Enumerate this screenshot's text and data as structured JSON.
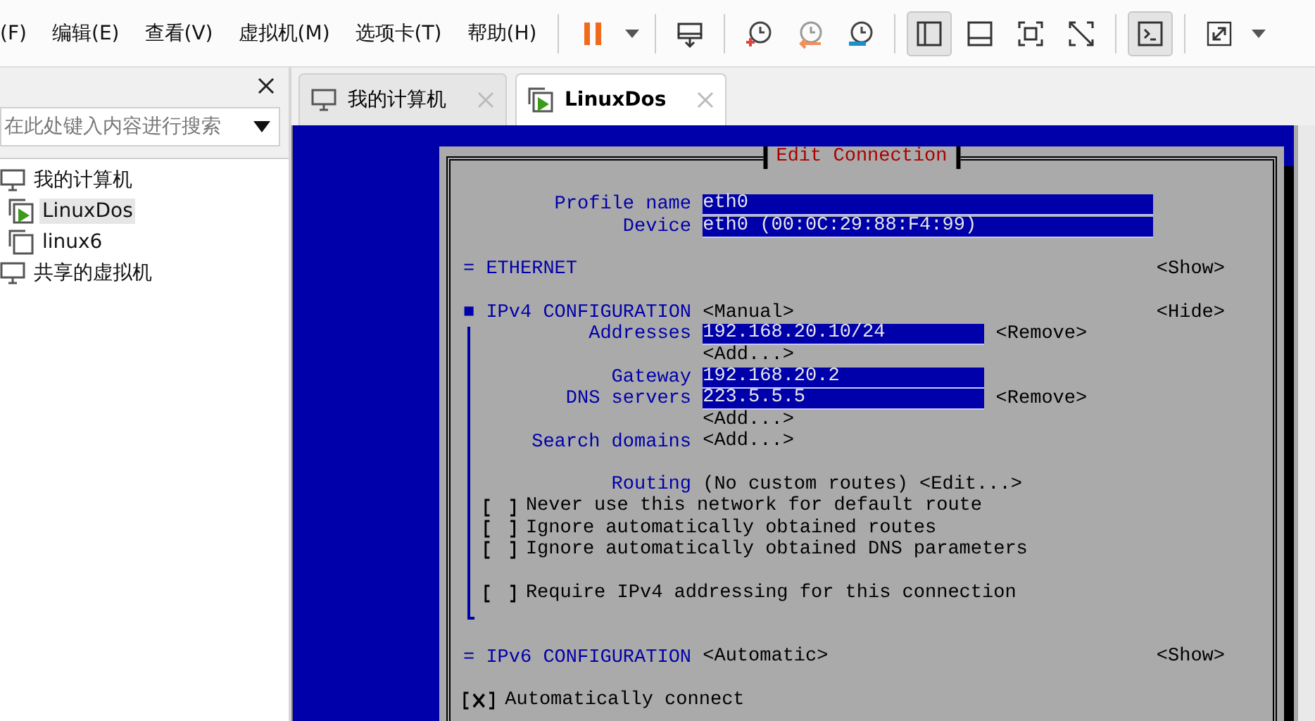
{
  "menu": [
    "(F)",
    "编辑(E)",
    "查看(V)",
    "虚拟机(M)",
    "选项卡(T)",
    "帮助(H)"
  ],
  "toolbar": [
    {
      "kind": "pause",
      "selected": false
    },
    {
      "kind": "caret",
      "selected": false
    },
    {
      "kind": "sep"
    },
    {
      "kind": "send-keys",
      "selected": false
    },
    {
      "kind": "sep"
    },
    {
      "kind": "snapshot-take",
      "selected": false
    },
    {
      "kind": "snapshot-revert",
      "selected": false
    },
    {
      "kind": "snapshot-manage",
      "selected": false
    },
    {
      "kind": "sep"
    },
    {
      "kind": "view-sidebar",
      "selected": true
    },
    {
      "kind": "view-bottom",
      "selected": false
    },
    {
      "kind": "view-fit",
      "selected": false
    },
    {
      "kind": "view-unity",
      "selected": false
    },
    {
      "kind": "sep"
    },
    {
      "kind": "console",
      "selected": true
    },
    {
      "kind": "sep"
    },
    {
      "kind": "fullscreen",
      "selected": false
    },
    {
      "kind": "caret",
      "selected": false
    }
  ],
  "sidebar": {
    "search": {
      "placeholder": "在此处键入内容进行搜索"
    },
    "tree": [
      {
        "label": "我的计算机",
        "kind": "computer",
        "selected": false,
        "children": [
          {
            "label": "LinuxDos",
            "kind": "vm-running",
            "selected": true
          },
          {
            "label": "linux6",
            "kind": "vm",
            "selected": false
          }
        ]
      },
      {
        "label": "共享的虚拟机",
        "kind": "computer",
        "selected": false
      }
    ]
  },
  "tabs": [
    {
      "label": "我的计算机",
      "kind": "computer",
      "selected": false
    },
    {
      "label": "LinuxDos",
      "kind": "vm-running",
      "selected": true
    }
  ],
  "dialog": {
    "title": "Edit Connection",
    "rows": [
      {
        "kind": "blank"
      },
      {
        "kind": "field",
        "label": "Profile name",
        "value": "eth0"
      },
      {
        "kind": "field",
        "label": "Device",
        "value": "eth0 (00:0C:29:88:F4:99)"
      },
      {
        "kind": "blank"
      },
      {
        "kind": "section",
        "marker": "=",
        "title": "ETHERNET",
        "toggle": "<Show>"
      },
      {
        "kind": "blank"
      },
      {
        "kind": "section",
        "marker": "■",
        "title": "IPv4 CONFIGURATION",
        "value": "<Manual>",
        "toggle": "<Hide>",
        "children": [
          {
            "kind": "field",
            "label": "Addresses",
            "value": "192.168.20.10/24",
            "button": "<Remove>"
          },
          {
            "kind": "button",
            "button": "<Add...>"
          },
          {
            "kind": "field",
            "label": "Gateway",
            "value": "192.168.20.2"
          },
          {
            "kind": "field",
            "label": "DNS servers",
            "value": "223.5.5.5",
            "button": "<Remove>"
          },
          {
            "kind": "button",
            "button": "<Add...>"
          },
          {
            "kind": "button",
            "label": "Search domains",
            "button": "<Add...>"
          },
          {
            "kind": "blank"
          },
          {
            "kind": "text",
            "label": "Routing",
            "value": "(No custom routes)",
            "button": "<Edit...>"
          },
          {
            "kind": "checkbox",
            "label": "Never use this network for default route",
            "checked": false
          },
          {
            "kind": "checkbox",
            "label": "Ignore automatically obtained routes",
            "checked": false
          },
          {
            "kind": "checkbox",
            "label": "Ignore automatically obtained DNS parameters",
            "checked": false
          },
          {
            "kind": "blank"
          },
          {
            "kind": "checkbox",
            "label": "Require IPv4 addressing for this connection",
            "checked": false
          }
        ]
      },
      {
        "kind": "blank"
      },
      {
        "kind": "section",
        "marker": "=",
        "title": "IPv6 CONFIGURATION",
        "value": "<Automatic>",
        "toggle": "<Show>"
      },
      {
        "kind": "blank"
      },
      {
        "kind": "checkbox",
        "label": "Automatically connect",
        "checked": true
      }
    ]
  }
}
